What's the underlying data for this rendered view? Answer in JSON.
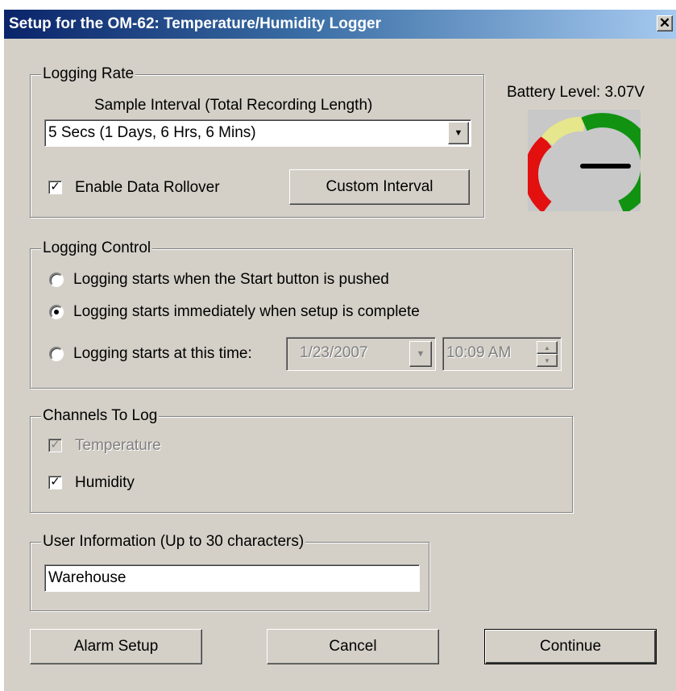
{
  "window": {
    "title": "Setup for the OM-62:  Temperature/Humidity Logger",
    "close_glyph": "✕"
  },
  "logging_rate": {
    "legend": "Logging Rate",
    "sample_caption": "Sample Interval  (Total Recording Length)",
    "selected_interval": "5 Secs  (1 Days, 6 Hrs, 6 Mins)",
    "rollover_label": "Enable Data Rollover",
    "rollover_checked": true,
    "custom_interval_label": "Custom Interval"
  },
  "battery": {
    "label": "Battery Level: 3.07V",
    "value_volts": 3.07,
    "gauge_colors": {
      "low": "#e31010",
      "mid": "#e6e68c",
      "high": "#119311",
      "needle": "#000000"
    }
  },
  "logging_control": {
    "legend": "Logging Control",
    "options": [
      {
        "label": "Logging starts when the Start button is pushed",
        "selected": false
      },
      {
        "label": "Logging starts immediately when setup is complete",
        "selected": true
      },
      {
        "label": "Logging starts at this time:",
        "selected": false
      }
    ],
    "start_date": "1/23/2007",
    "start_time": "10:09 AM"
  },
  "channels": {
    "legend": "Channels To Log",
    "items": [
      {
        "label": "Temperature",
        "checked": true,
        "enabled": false
      },
      {
        "label": "Humidity",
        "checked": true,
        "enabled": true
      }
    ]
  },
  "user_info": {
    "legend": "User Information (Up to 30 characters)",
    "value": "Warehouse"
  },
  "buttons": {
    "alarm_setup": "Alarm Setup",
    "cancel": "Cancel",
    "continue": "Continue"
  },
  "glyphs": {
    "check": "✓",
    "dropdown_arrow": "▼",
    "spin_up": "▲",
    "spin_down": "▼"
  }
}
